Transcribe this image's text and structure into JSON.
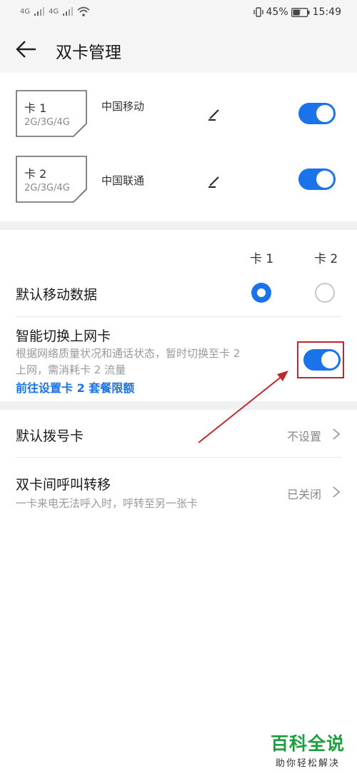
{
  "status_bar": {
    "signal_1": "4G",
    "signal_2": "4G",
    "battery": "45%",
    "time": "15:49"
  },
  "header": {
    "title": "双卡管理"
  },
  "sims": [
    {
      "label": "卡 1",
      "bands": "2G/3G/4G",
      "carrier": "中国移动",
      "enabled": true
    },
    {
      "label": "卡 2",
      "bands": "2G/3G/4G",
      "carrier": "中国联通",
      "enabled": true
    }
  ],
  "columns": {
    "sim1": "卡 1",
    "sim2": "卡 2"
  },
  "default_data": {
    "title": "默认移动数据",
    "selected": "sim1"
  },
  "smart_switch": {
    "title": "智能切换上网卡",
    "desc_line1": "根据网络质量状况和通话状态，暂时切换至卡 2",
    "desc_line2": "上网，需消耗卡 2 流量",
    "link": "前往设置卡 2 套餐限额",
    "enabled": true
  },
  "default_dial": {
    "title": "默认拨号卡",
    "value": "不设置"
  },
  "call_forward": {
    "title": "双卡间呼叫转移",
    "desc": "一卡来电无法呼入时，呼转至另一张卡",
    "value": "已关闭"
  },
  "watermark": {
    "brand": "百科全说",
    "tagline": "助你轻松解决"
  },
  "colors": {
    "accent": "#1a73e8",
    "annotation": "#c0262d",
    "watermark": "#1e9e3e"
  }
}
